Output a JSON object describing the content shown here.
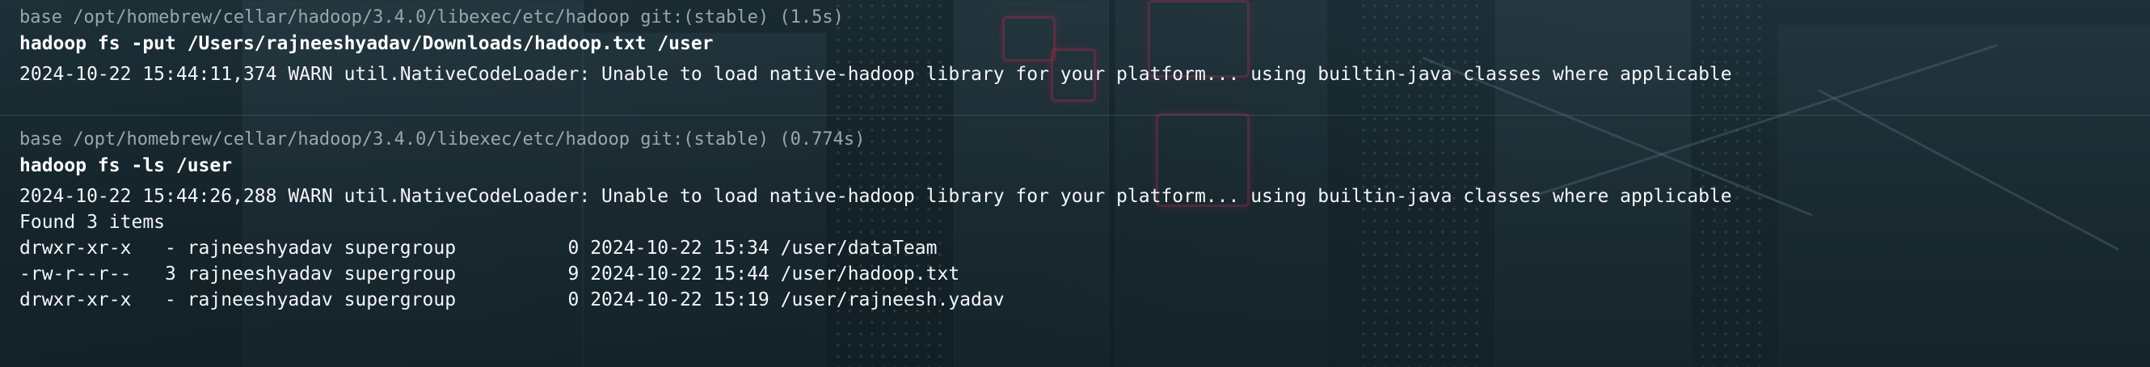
{
  "blocks": [
    {
      "prompt": "base /opt/homebrew/cellar/hadoop/3.4.0/libexec/etc/hadoop git:(stable) (1.5s)",
      "command": "hadoop fs -put /Users/rajneeshyadav/Downloads/hadoop.txt /user",
      "output": [
        "2024-10-22 15:44:11,374 WARN util.NativeCodeLoader: Unable to load native-hadoop library for your platform... using builtin-java classes where applicable"
      ]
    },
    {
      "prompt": "base /opt/homebrew/cellar/hadoop/3.4.0/libexec/etc/hadoop git:(stable) (0.774s)",
      "command": "hadoop fs -ls /user",
      "output": [
        "2024-10-22 15:44:26,288 WARN util.NativeCodeLoader: Unable to load native-hadoop library for your platform... using builtin-java classes where applicable",
        "Found 3 items",
        "drwxr-xr-x   - rajneeshyadav supergroup          0 2024-10-22 15:34 /user/dataTeam",
        "-rw-r--r--   3 rajneeshyadav supergroup          9 2024-10-22 15:44 /user/hadoop.txt",
        "drwxr-xr-x   - rajneeshyadav supergroup          0 2024-10-22 15:19 /user/rajneesh.yadav"
      ]
    }
  ]
}
